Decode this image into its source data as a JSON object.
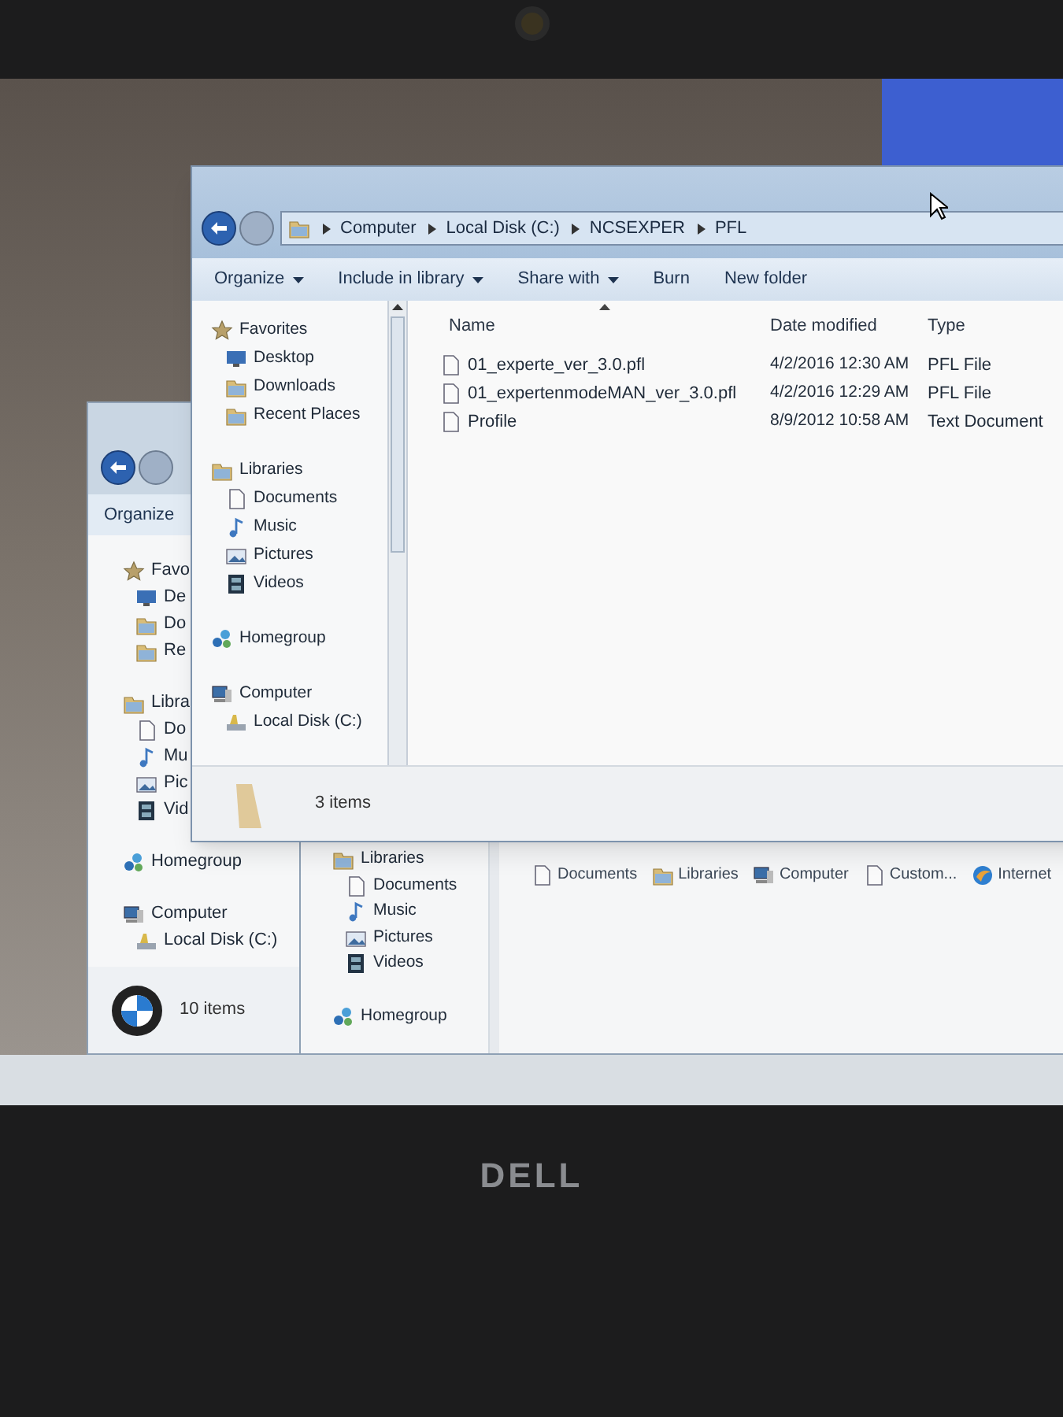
{
  "back_window": {
    "toolbar": [
      "Organize"
    ],
    "nav": [
      {
        "label": "Favo",
        "kind": "star",
        "children": [
          {
            "label": "De",
            "kind": "desktop"
          },
          {
            "label": "Do",
            "kind": "downloads"
          },
          {
            "label": "Re",
            "kind": "recent"
          }
        ]
      },
      {
        "label": "Libra",
        "kind": "library",
        "children": [
          {
            "label": "Do",
            "kind": "documents"
          },
          {
            "label": "Mu",
            "kind": "music"
          },
          {
            "label": "Pic",
            "kind": "pictures"
          },
          {
            "label": "Vid",
            "kind": "videos"
          }
        ]
      },
      {
        "label": "Homegroup",
        "kind": "homegroup"
      },
      {
        "label": "Computer",
        "kind": "computer",
        "children": [
          {
            "label": "Local Disk (C:)",
            "kind": "disk"
          }
        ]
      }
    ],
    "status": "10 items"
  },
  "middle_window": {
    "nav": [
      {
        "label": "Libraries",
        "kind": "library",
        "children": [
          {
            "label": "Documents",
            "kind": "documents"
          },
          {
            "label": "Music",
            "kind": "music"
          },
          {
            "label": "Pictures",
            "kind": "pictures"
          },
          {
            "label": "Videos",
            "kind": "videos"
          }
        ]
      },
      {
        "label": "Homegroup",
        "kind": "homegroup"
      }
    ],
    "links": [
      {
        "label": "Documents",
        "kind": "documents"
      },
      {
        "label": "Libraries",
        "kind": "library"
      },
      {
        "label": "Computer",
        "kind": "computer"
      },
      {
        "label": "Custom...",
        "kind": "custom"
      },
      {
        "label": "Internet",
        "kind": "internet"
      }
    ]
  },
  "front_window": {
    "address": [
      "Computer",
      "Local Disk (C:)",
      "NCSEXPER",
      "PFL"
    ],
    "toolbar": [
      {
        "label": "Organize",
        "menu": true
      },
      {
        "label": "Include in library",
        "menu": true
      },
      {
        "label": "Share with",
        "menu": true
      },
      {
        "label": "Burn",
        "menu": false
      },
      {
        "label": "New folder",
        "menu": false
      }
    ],
    "nav": [
      {
        "label": "Favorites",
        "kind": "star",
        "children": [
          {
            "label": "Desktop",
            "kind": "desktop"
          },
          {
            "label": "Downloads",
            "kind": "downloads"
          },
          {
            "label": "Recent Places",
            "kind": "recent"
          }
        ]
      },
      {
        "label": "Libraries",
        "kind": "library",
        "children": [
          {
            "label": "Documents",
            "kind": "documents"
          },
          {
            "label": "Music",
            "kind": "music"
          },
          {
            "label": "Pictures",
            "kind": "pictures"
          },
          {
            "label": "Videos",
            "kind": "videos"
          }
        ]
      },
      {
        "label": "Homegroup",
        "kind": "homegroup"
      },
      {
        "label": "Computer",
        "kind": "computer",
        "children": [
          {
            "label": "Local Disk (C:)",
            "kind": "disk"
          }
        ]
      }
    ],
    "columns": [
      {
        "label": "Name",
        "sorted": true
      },
      {
        "label": "Date modified",
        "sorted": false
      },
      {
        "label": "Type",
        "sorted": false
      }
    ],
    "rows": [
      {
        "name": "01_experte_ver_3.0.pfl",
        "date": "4/2/2016 12:30 AM",
        "type": "PFL File"
      },
      {
        "name": "01_expertenmodeMAN_ver_3.0.pfl",
        "date": "4/2/2016 12:29 AM",
        "type": "PFL File"
      },
      {
        "name": "Profile",
        "date": "8/9/2012 10:58 AM",
        "type": "Text Document"
      }
    ],
    "status": "3 items"
  },
  "bezel": {
    "logo": "DELL"
  }
}
